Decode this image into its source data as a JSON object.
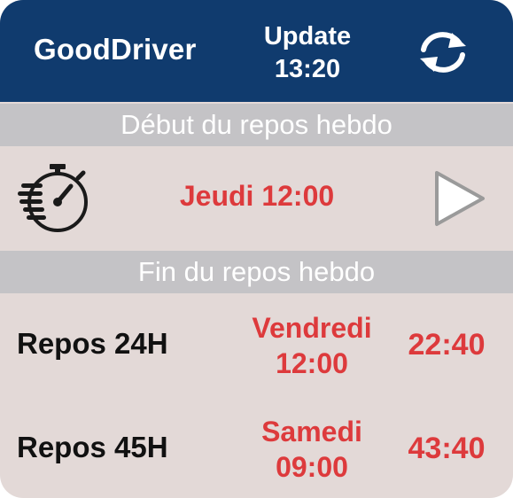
{
  "header": {
    "app_title": "GoodDriver",
    "update_label": "Update",
    "update_time": "13:20",
    "refresh_icon": "refresh-icon"
  },
  "start_section": {
    "title": "Début du repos hebdo",
    "icon": "stopwatch-icon",
    "time": "Jeudi 12:00",
    "action_icon": "play-icon"
  },
  "end_section": {
    "title": "Fin du repos hebdo",
    "rows": [
      {
        "label": "Repos 24H",
        "end_day": "Vendredi",
        "end_time": "12:00",
        "duration": "22:40"
      },
      {
        "label": "Repos 45H",
        "end_day": "Samedi",
        "end_time": "09:00",
        "duration": "43:40"
      }
    ]
  },
  "colors": {
    "header_bg": "#103b6e",
    "body_bg": "#e3d9d7",
    "section_header_bg": "#c4c3c6",
    "accent_red": "#dd3a3c"
  }
}
